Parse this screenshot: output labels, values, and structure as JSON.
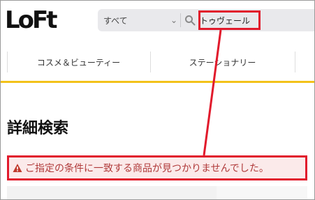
{
  "brand": {
    "logo_text": "LoFt"
  },
  "search": {
    "scope_selected": "すべて",
    "query": "トゥヴェール"
  },
  "nav": {
    "items": [
      {
        "label": "コスメ＆ビューティー"
      },
      {
        "label": "ステーショナリー"
      }
    ]
  },
  "main": {
    "title": "詳細検索",
    "notice": "ご指定の条件に一致する商品が見つかりませんでした。"
  },
  "colors": {
    "accent_yellow": "#f3c21a",
    "annotation_red": "#e11a2c",
    "notice_text": "#b03a3a",
    "notice_bg": "#fbeaea"
  },
  "icons": {
    "search": "search-icon",
    "dropdown": "chevron-down-icon",
    "warning": "warning-icon"
  }
}
